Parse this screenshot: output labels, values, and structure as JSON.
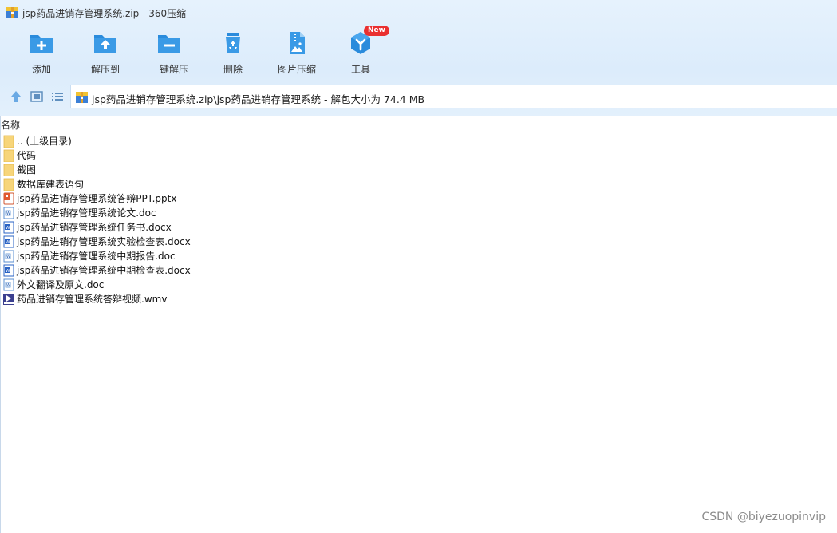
{
  "window": {
    "title": "jsp药品进销存管理系统.zip - 360压缩"
  },
  "toolbar": {
    "items": [
      {
        "label": "添加",
        "icon": "add-folder-icon"
      },
      {
        "label": "解压到",
        "icon": "extract-to-icon"
      },
      {
        "label": "一键解压",
        "icon": "one-click-extract-icon"
      },
      {
        "label": "删除",
        "icon": "recycle-bin-icon"
      },
      {
        "label": "图片压缩",
        "icon": "image-compress-icon"
      },
      {
        "label": "工具",
        "icon": "tools-icon",
        "badge": "New"
      }
    ]
  },
  "address": {
    "path": "jsp药品进销存管理系统.zip\\jsp药品进销存管理系统 - 解包大小为 74.4 MB"
  },
  "list": {
    "column_name": "名称",
    "items": [
      {
        "name": ".. (上级目录)",
        "type": "folder"
      },
      {
        "name": "代码",
        "type": "folder"
      },
      {
        "name": "截图",
        "type": "folder"
      },
      {
        "name": "数据库建表语句",
        "type": "folder"
      },
      {
        "name": "jsp药品进销存管理系统答辩PPT.pptx",
        "type": "pptx"
      },
      {
        "name": "jsp药品进销存管理系统论文.doc",
        "type": "doc"
      },
      {
        "name": "jsp药品进销存管理系统任务书.docx",
        "type": "docx"
      },
      {
        "name": "jsp药品进销存管理系统实验检查表.docx",
        "type": "docx"
      },
      {
        "name": "jsp药品进销存管理系统中期报告.doc",
        "type": "doc"
      },
      {
        "name": "jsp药品进销存管理系统中期检查表.docx",
        "type": "docx"
      },
      {
        "name": "外文翻译及原文.doc",
        "type": "doc"
      },
      {
        "name": "药品进销存管理系统答辩视频.wmv",
        "type": "wmv"
      }
    ]
  },
  "watermark": "CSDN @biyezuopinvip",
  "colors": {
    "accent": "#2a8bdc",
    "chrome_bg": "#dcecfb",
    "folder": "#f7d57a"
  }
}
